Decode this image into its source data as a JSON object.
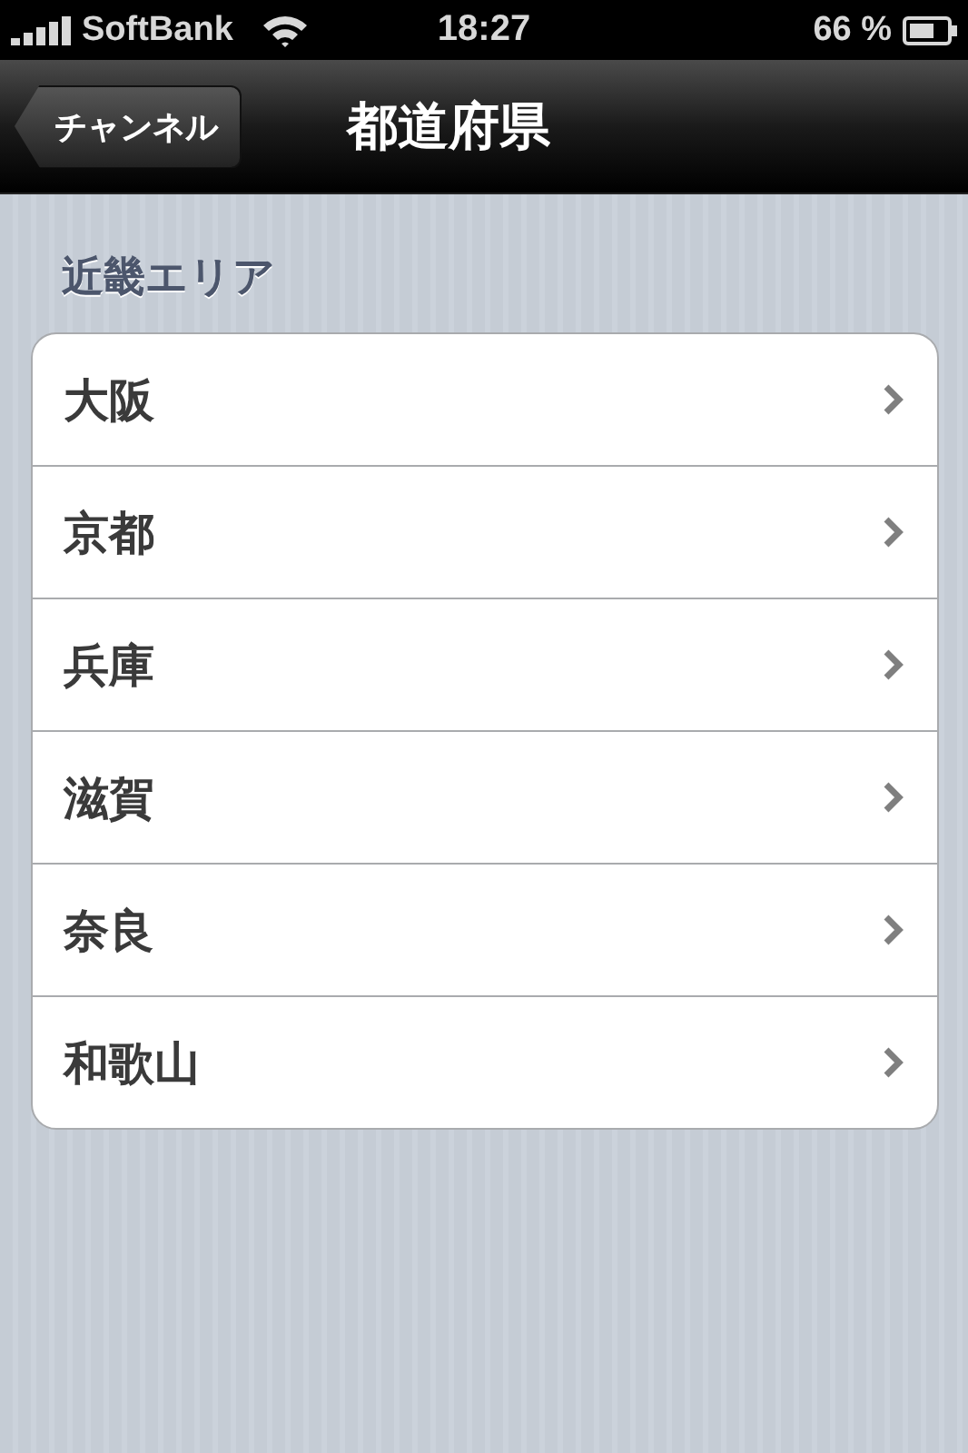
{
  "status_bar": {
    "carrier": "SoftBank",
    "time": "18:27",
    "battery": "66 %"
  },
  "nav_bar": {
    "back": "チャンネル",
    "title": "都道府県"
  },
  "section": {
    "header": "近畿エリア",
    "rows": [
      {
        "label": "大阪"
      },
      {
        "label": "京都"
      },
      {
        "label": "兵庫"
      },
      {
        "label": "滋賀"
      },
      {
        "label": "奈良"
      },
      {
        "label": "和歌山"
      }
    ]
  }
}
